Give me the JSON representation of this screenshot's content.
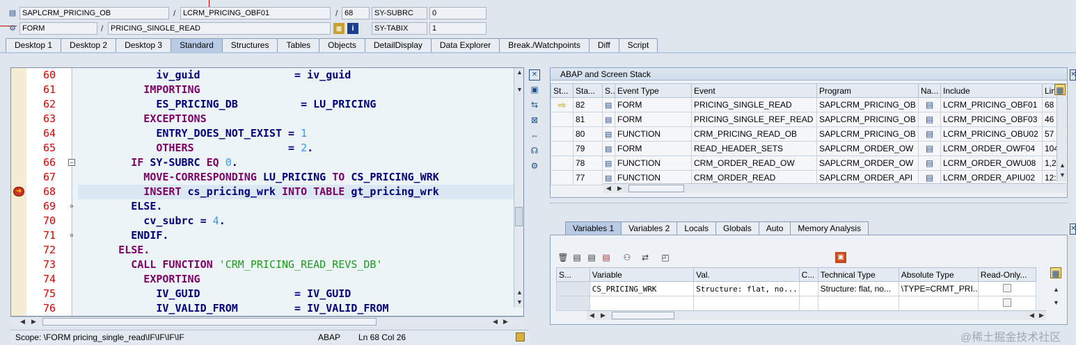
{
  "header": {
    "program": "SAPLCRM_PRICING_OB",
    "include": "LCRM_PRICING_OBF01",
    "line": "68",
    "sy_subrc_label": "SY-SUBRC",
    "sy_subrc_value": "0",
    "event_type": "FORM",
    "event": "PRICING_SINGLE_READ",
    "sy_tabix_label": "SY-TABIX",
    "sy_tabix_value": "1",
    "slash": "/"
  },
  "tabs": [
    "Desktop 1",
    "Desktop 2",
    "Desktop 3",
    "Standard",
    "Structures",
    "Tables",
    "Objects",
    "DetailDisplay",
    "Data Explorer",
    "Break./Watchpoints",
    "Diff",
    "Script"
  ],
  "active_tab": "Standard",
  "code_lines": [
    {
      "n": "60",
      "parts": [
        [
          "id",
          "            iv_guid"
        ],
        [
          "op",
          "               = "
        ],
        [
          "id",
          "iv_guid"
        ]
      ]
    },
    {
      "n": "61",
      "parts": [
        [
          "kw",
          "          IMPORTING"
        ]
      ]
    },
    {
      "n": "62",
      "parts": [
        [
          "id",
          "            ES_PRICING_DB"
        ],
        [
          "op",
          "          = "
        ],
        [
          "id",
          "LU_PRICING"
        ]
      ]
    },
    {
      "n": "63",
      "parts": [
        [
          "kw",
          "          EXCEPTIONS"
        ]
      ]
    },
    {
      "n": "64",
      "parts": [
        [
          "id",
          "            ENTRY_DOES_NOT_EXIST"
        ],
        [
          "op",
          " = "
        ],
        [
          "num",
          "1"
        ]
      ]
    },
    {
      "n": "65",
      "parts": [
        [
          "kw",
          "            OTHERS"
        ],
        [
          "op",
          "               = "
        ],
        [
          "num",
          "2"
        ],
        [
          "op",
          "."
        ]
      ]
    },
    {
      "n": "66",
      "parts": [
        [
          "kw",
          "        IF "
        ],
        [
          "id",
          "SY-SUBRC"
        ],
        [
          "kw",
          " EQ "
        ],
        [
          "num",
          "0"
        ],
        [
          "op",
          "."
        ]
      ]
    },
    {
      "n": "67",
      "parts": [
        [
          "kw",
          "          MOVE-CORRESPONDING "
        ],
        [
          "id",
          "LU_PRICING"
        ],
        [
          "kw",
          " TO "
        ],
        [
          "id",
          "CS_PRICING_WRK"
        ]
      ]
    },
    {
      "n": "68",
      "parts": [
        [
          "kw",
          "          INSERT "
        ],
        [
          "id",
          "cs_pricing_wrk"
        ],
        [
          "kw",
          " INTO TABLE "
        ],
        [
          "id",
          "gt_pricing_wrk"
        ]
      ]
    },
    {
      "n": "69",
      "parts": [
        [
          "id",
          "        ELSE."
        ]
      ]
    },
    {
      "n": "70",
      "parts": [
        [
          "id",
          "          cv_subrc"
        ],
        [
          "op",
          " = "
        ],
        [
          "num",
          "4"
        ],
        [
          "op",
          "."
        ]
      ]
    },
    {
      "n": "71",
      "parts": [
        [
          "id",
          "        ENDIF."
        ]
      ]
    },
    {
      "n": "72",
      "parts": [
        [
          "kw",
          "      ELSE."
        ]
      ]
    },
    {
      "n": "73",
      "parts": [
        [
          "kw",
          "        CALL FUNCTION "
        ],
        [
          "str",
          "'CRM_PRICING_READ_REVS_DB'"
        ]
      ]
    },
    {
      "n": "74",
      "parts": [
        [
          "kw",
          "          EXPORTING"
        ]
      ]
    },
    {
      "n": "75",
      "parts": [
        [
          "id",
          "            IV_GUID"
        ],
        [
          "op",
          "               = "
        ],
        [
          "id",
          "IV_GUID"
        ]
      ]
    },
    {
      "n": "76",
      "parts": [
        [
          "id",
          "            IV_VALID_FROM"
        ],
        [
          "op",
          "         = "
        ],
        [
          "id",
          "IV_VALID_FROM"
        ]
      ]
    }
  ],
  "status": {
    "scope": "Scope: \\FORM pricing_single_read\\IF\\IF\\IF\\IF",
    "lang": "ABAP",
    "ln_col": "Ln  68 Col  26"
  },
  "stack": {
    "title": "ABAP and Screen Stack",
    "headers": [
      "St...",
      "Sta...",
      "S...",
      "Event Type",
      "Event",
      "Program",
      "Na...",
      "Include",
      "Lin"
    ],
    "rows": [
      {
        "sta": "82",
        "type": "FORM",
        "event": "PRICING_SINGLE_READ",
        "program": "SAPLCRM_PRICING_OB",
        "include": "LCRM_PRICING_OBF01",
        "line": "68",
        "current": true
      },
      {
        "sta": "81",
        "type": "FORM",
        "event": "PRICING_SINGLE_REF_READ",
        "program": "SAPLCRM_PRICING_OB",
        "include": "LCRM_PRICING_OBF03",
        "line": "46",
        "current": false
      },
      {
        "sta": "80",
        "type": "FUNCTION",
        "event": "CRM_PRICING_READ_OB",
        "program": "SAPLCRM_PRICING_OB",
        "include": "LCRM_PRICING_OBU02",
        "line": "57",
        "current": false
      },
      {
        "sta": "79",
        "type": "FORM",
        "event": "READ_HEADER_SETS",
        "program": "SAPLCRM_ORDER_OW",
        "include": "LCRM_ORDER_OWF04",
        "line": "104",
        "current": false
      },
      {
        "sta": "78",
        "type": "FUNCTION",
        "event": "CRM_ORDER_READ_OW",
        "program": "SAPLCRM_ORDER_OW",
        "include": "LCRM_ORDER_OWU08",
        "line": "1,2",
        "current": false
      },
      {
        "sta": "77",
        "type": "FUNCTION",
        "event": "CRM_ORDER_READ",
        "program": "SAPLCRM_ORDER_API",
        "include": "LCRM_ORDER_APIU02",
        "line": "12:",
        "current": false
      }
    ]
  },
  "vartabs": [
    "Variables 1",
    "Variables 2",
    "Locals",
    "Globals",
    "Auto",
    "Memory Analysis"
  ],
  "vars": {
    "headers": [
      "S...",
      "Variable",
      "Val.",
      "C...",
      "Technical Type",
      "Absolute Type",
      "Read-Only..."
    ],
    "rows": [
      {
        "name": "CS_PRICING_WRK",
        "val": "Structure: flat, no...",
        "tech": "Structure: flat, no...",
        "abs": "\\TYPE=CRMT_PRI..."
      },
      {
        "name": "",
        "val": "",
        "tech": "",
        "abs": ""
      }
    ]
  },
  "watermark": "@稀土掘金技术社区"
}
